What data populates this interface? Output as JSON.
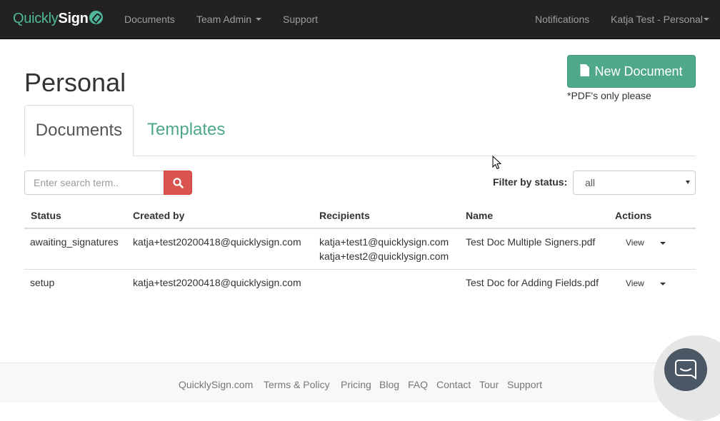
{
  "navbar": {
    "brand_part1": "Quickly",
    "brand_part2": "Sign",
    "links": [
      "Documents",
      "Team Admin",
      "Support"
    ],
    "notifications": "Notifications",
    "user_menu": "Katja Test - Personal"
  },
  "header": {
    "title": "Personal",
    "new_document_label": "New Document",
    "pdf_note": "*PDF's only please"
  },
  "tabs": [
    "Documents",
    "Templates"
  ],
  "search": {
    "placeholder": "Enter search term..",
    "filter_label": "Filter by status:",
    "filter_value": "all"
  },
  "table": {
    "columns": [
      "Status",
      "Created by",
      "Recipients",
      "Name",
      "Actions"
    ],
    "rows": [
      {
        "status": "awaiting_signatures",
        "created_by": "katja+test20200418@quicklysign.com",
        "recipients": [
          "katja+test1@quicklysign.com",
          "katja+test2@quicklysign.com"
        ],
        "name": "Test Doc Multiple Signers.pdf",
        "action": "View"
      },
      {
        "status": "setup",
        "created_by": "katja+test20200418@quicklysign.com",
        "recipients": [],
        "name": "Test Doc for Adding Fields.pdf",
        "action": "View"
      }
    ]
  },
  "footer": {
    "links": [
      "QuicklySign.com",
      "Terms & Policy",
      "Pricing",
      "Blog",
      "FAQ",
      "Contact",
      "Tour",
      "Support"
    ]
  },
  "colors": {
    "navbar_bg": "#222222",
    "brand_accent": "#4fb99a",
    "primary_button": "#4fa88a",
    "search_button": "#d9534f",
    "chat_button": "#4a5866"
  },
  "icons": {
    "brand": "pen-nib-icon",
    "new_document": "file-icon",
    "search": "search-icon",
    "chat": "chat-icon"
  }
}
